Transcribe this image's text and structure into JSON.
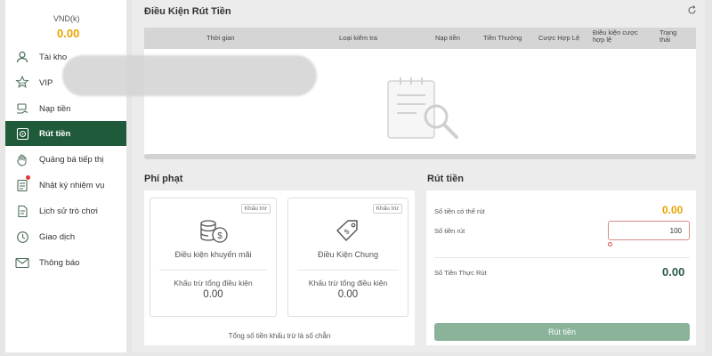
{
  "sidebar": {
    "balance_label": "VND(k)",
    "balance_value": "0.00",
    "items": [
      {
        "label": "Tài kho",
        "icon": "user-icon"
      },
      {
        "label": "VIP",
        "icon": "vip-star-icon"
      },
      {
        "label": "Nạp tiền",
        "icon": "deposit-icon"
      },
      {
        "label": "Rút tiền",
        "icon": "withdraw-icon",
        "active": true
      },
      {
        "label": "Quảng bá tiếp thị",
        "icon": "promo-hand-icon"
      },
      {
        "label": "Nhật ký nhiệm vụ",
        "icon": "task-log-icon",
        "notification": true
      },
      {
        "label": "Lịch sử trò chơi",
        "icon": "game-history-icon"
      },
      {
        "label": "Giao dịch",
        "icon": "transaction-clock-icon"
      },
      {
        "label": "Thông báo",
        "icon": "mail-icon"
      }
    ]
  },
  "conditions": {
    "title": "Điều Kiện Rút Tiền",
    "columns": [
      "Thời gian",
      "Loại kiểm tra",
      "Nạp tiền",
      "Tiền Thưởng",
      "Cược Hợp Lệ",
      "Điều kiện cược hợp lệ",
      "Trạng thái"
    ]
  },
  "penalty": {
    "title": "Phí phạt",
    "cards": [
      {
        "badge": "Khấu trừ",
        "name": "Điều kiện khuyến mãi",
        "sub_label": "Khấu trừ tổng điều kiện",
        "value": "0.00",
        "icon": "coins-dollar-icon"
      },
      {
        "badge": "Khấu trừ",
        "name": "Điều Kiện Chung",
        "sub_label": "Khấu trừ tổng điều kiện",
        "value": "0.00",
        "icon": "price-tag-icon"
      }
    ],
    "footer": "Tổng số tiền khấu trừ là số chẵn"
  },
  "withdraw": {
    "title": "Rút tiền",
    "available_label": "Số tiền có thể rút",
    "available_value": "0.00",
    "amount_label": "Số tiền rút",
    "amount_value": "100",
    "actual_label": "Số Tiền Thực Rút",
    "actual_value": "0.00",
    "submit_label": "Rút tiền"
  },
  "colors": {
    "accent_green": "#1f5a3a",
    "gold": "#e8a300",
    "button_disabled": "#8ab39a"
  }
}
